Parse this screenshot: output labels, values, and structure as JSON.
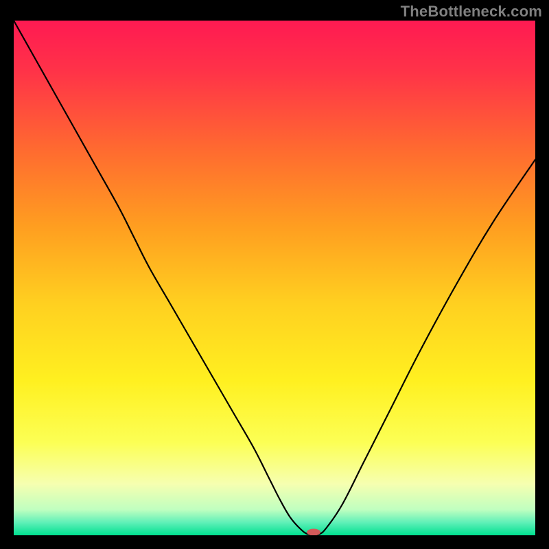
{
  "watermark": "TheBottleneck.com",
  "chart_data": {
    "type": "line",
    "title": "",
    "xlabel": "",
    "ylabel": "",
    "xlim": [
      0,
      100
    ],
    "ylim": [
      0,
      100
    ],
    "legend": false,
    "grid": false,
    "gradient_stops": [
      {
        "offset": 0.0,
        "color": "#ff1a52"
      },
      {
        "offset": 0.1,
        "color": "#ff3348"
      },
      {
        "offset": 0.25,
        "color": "#ff6a30"
      },
      {
        "offset": 0.4,
        "color": "#ff9e20"
      },
      {
        "offset": 0.55,
        "color": "#ffd020"
      },
      {
        "offset": 0.7,
        "color": "#fff020"
      },
      {
        "offset": 0.82,
        "color": "#fcff55"
      },
      {
        "offset": 0.9,
        "color": "#f6ffb0"
      },
      {
        "offset": 0.95,
        "color": "#c0ffc0"
      },
      {
        "offset": 0.975,
        "color": "#60f0b8"
      },
      {
        "offset": 1.0,
        "color": "#00e090"
      }
    ],
    "series": [
      {
        "name": "bottleneck-curve",
        "x": [
          0,
          5,
          10,
          15,
          20,
          23,
          26,
          30,
          34,
          38,
          42,
          46,
          49,
          51,
          53,
          55,
          56.5,
          58.5,
          60,
          63,
          67,
          72,
          78,
          85,
          92,
          100
        ],
        "y": [
          100,
          91,
          82,
          73,
          64,
          58,
          52,
          45,
          38,
          31,
          24,
          17,
          11,
          7,
          3.5,
          1.2,
          0.2,
          0.2,
          1.5,
          6,
          14,
          24,
          36,
          49,
          61,
          73
        ]
      }
    ],
    "marker": {
      "label": "optimal-point",
      "x": 57.5,
      "y": 0.6,
      "color": "#d45a5a",
      "rx": 10,
      "ry": 5
    }
  }
}
